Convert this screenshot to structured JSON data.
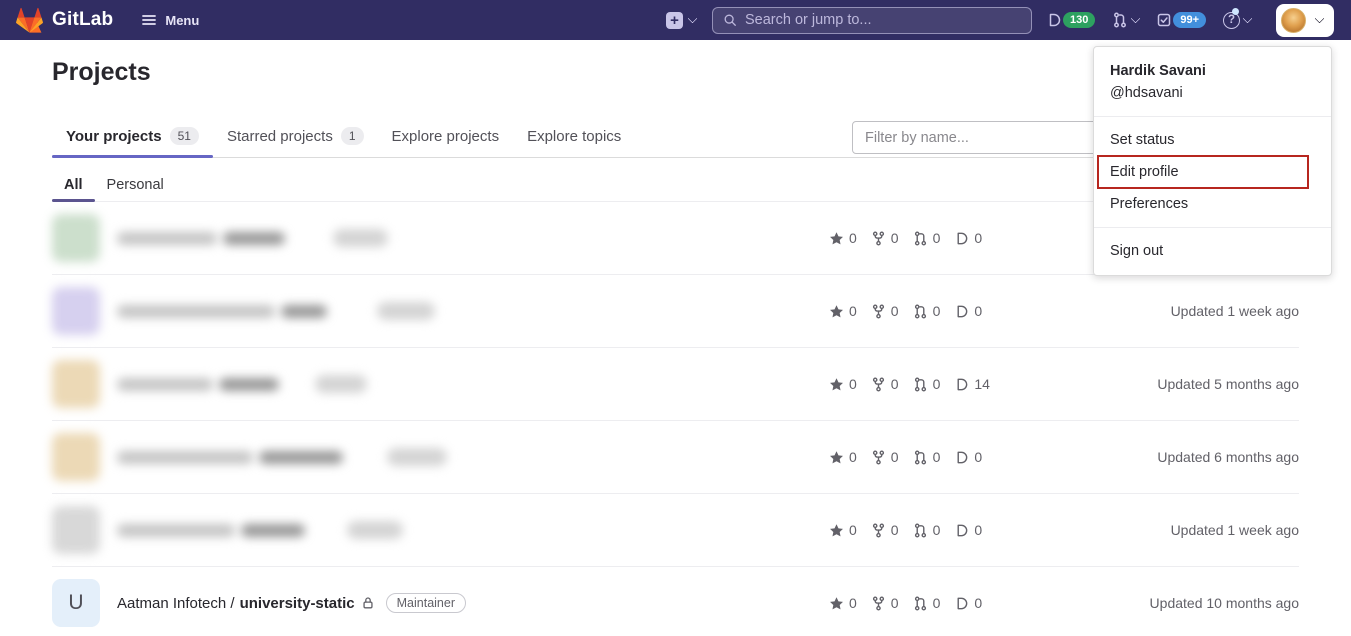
{
  "navbar": {
    "logo_text": "GitLab",
    "menu_label": "Menu",
    "search_placeholder": "Search or jump to...",
    "issues_badge": "130",
    "todos_badge": "99+"
  },
  "page_title": "Projects",
  "tabs": [
    {
      "label": "Your projects",
      "count": "51"
    },
    {
      "label": "Starred projects",
      "count": "1"
    },
    {
      "label": "Explore projects",
      "count": ""
    },
    {
      "label": "Explore topics",
      "count": ""
    }
  ],
  "filter_placeholder": "Filter by name...",
  "subtabs": [
    {
      "label": "All"
    },
    {
      "label": "Personal"
    }
  ],
  "user_menu": {
    "name": "Hardik Savani",
    "username": "@hdsavani",
    "set_status": "Set status",
    "edit_profile": "Edit profile",
    "preferences": "Preferences",
    "sign_out": "Sign out",
    "highlighted_item": "Edit profile"
  },
  "colors": {
    "navbar_bg": "#312d63",
    "issues_badge_bg": "#2da160",
    "todos_badge_bg": "#428fdc",
    "active_tab_underline": "#6666c4",
    "subtab_underline": "#5b548f",
    "annotation_red": "#b7261f"
  },
  "projects": [
    {
      "redacted": true,
      "stars": "0",
      "forks": "0",
      "mrs": "0",
      "issues": "0",
      "updated": ""
    },
    {
      "redacted": true,
      "stars": "0",
      "forks": "0",
      "mrs": "0",
      "issues": "0",
      "updated": "Updated 1 week ago"
    },
    {
      "redacted": true,
      "stars": "0",
      "forks": "0",
      "mrs": "0",
      "issues": "14",
      "updated": "Updated 5 months ago"
    },
    {
      "redacted": true,
      "stars": "0",
      "forks": "0",
      "mrs": "0",
      "issues": "0",
      "updated": "Updated 6 months ago"
    },
    {
      "redacted": true,
      "stars": "0",
      "forks": "0",
      "mrs": "0",
      "issues": "0",
      "updated": "Updated 1 week ago"
    },
    {
      "redacted": false,
      "avatar_letter": "U",
      "namespace": "Aatman Infotech /",
      "name": "university-static",
      "visibility": "private",
      "role": "Maintainer",
      "stars": "0",
      "forks": "0",
      "mrs": "0",
      "issues": "0",
      "updated": "Updated 10 months ago"
    }
  ]
}
